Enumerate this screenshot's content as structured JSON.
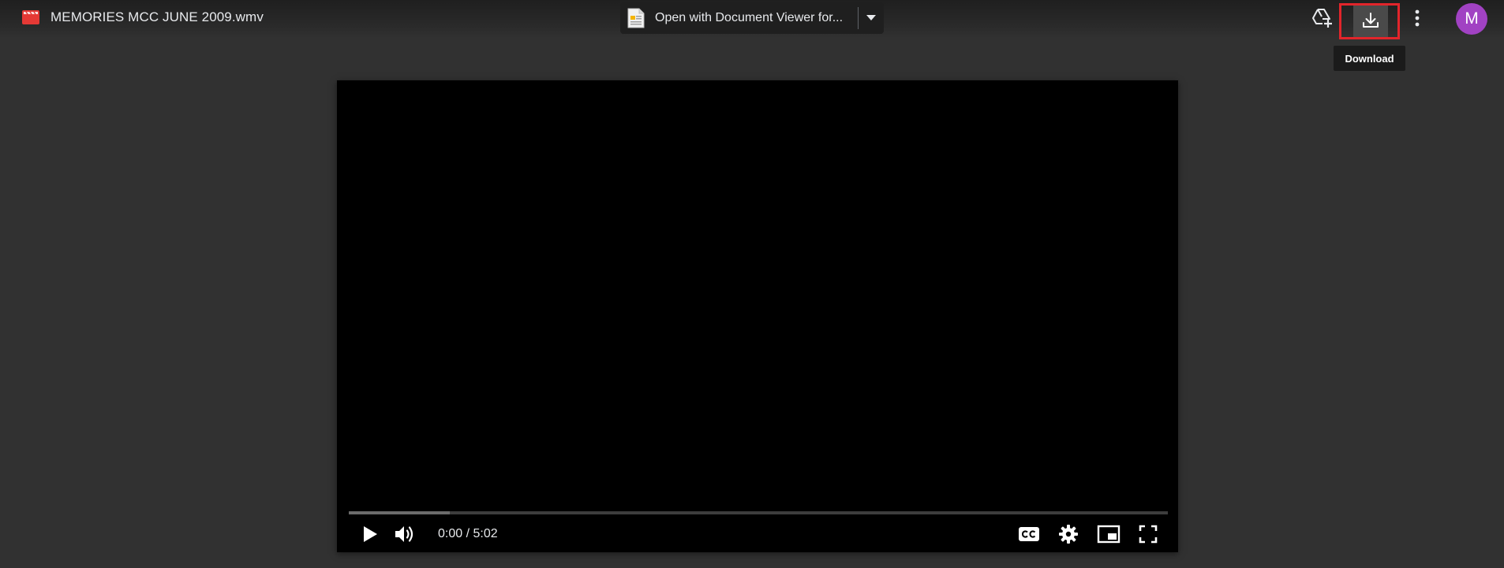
{
  "file": {
    "name": "MEMORIES MCC JUNE 2009.wmv",
    "icon": "video-file-icon"
  },
  "open_with": {
    "label": "Open with Document Viewer for...",
    "icon": "document-viewer-icon"
  },
  "toolbar": {
    "add_to_drive_icon": "add-to-drive-icon",
    "download_icon": "download-icon",
    "more_icon": "more-vert-icon"
  },
  "tooltip": {
    "text": "Download"
  },
  "avatar": {
    "initial": "M",
    "color": "#a142c3"
  },
  "player": {
    "time": "0:00 / 5:02",
    "buffered_fraction": 0.123
  },
  "colors": {
    "background": "#313131",
    "highlight": "#e2252b",
    "file_icon": "#e53935"
  }
}
